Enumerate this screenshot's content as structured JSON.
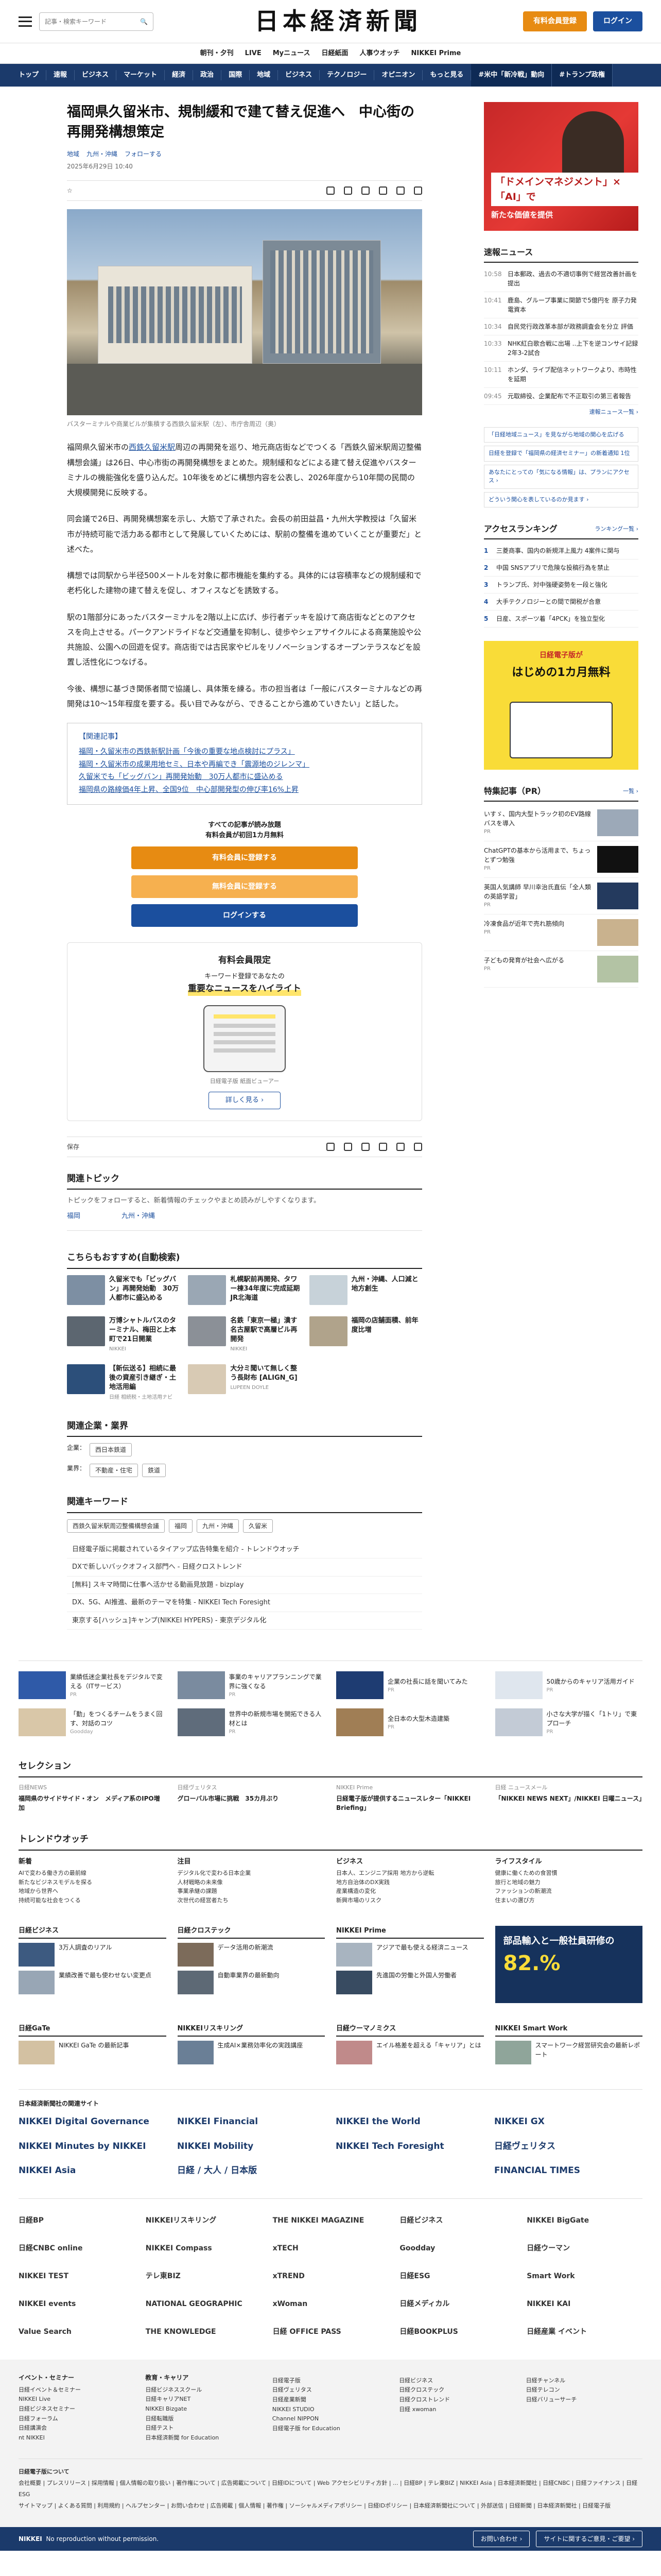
{
  "header": {
    "search_placeholder": "記事・検索キーワード",
    "logo": "日本経済新聞",
    "subscribe_label": "有料会員登録",
    "login_label": "ログイン"
  },
  "subnav": [
    "朝刊・夕刊",
    "LIVE",
    "Myニュース",
    "日経紙面",
    "人事ウオッチ",
    "NIKKEI Prime"
  ],
  "mainnav": [
    "トップ",
    "速報",
    "ビジネス",
    "マーケット",
    "経済",
    "政治",
    "国際",
    "地域",
    "ビジネス",
    "テクノロジー",
    "オピニオン",
    "もっと見る",
    "#米中「新冷戦」動向",
    "#トランプ政権"
  ],
  "article": {
    "title": "福岡県久留米市、規制緩和で建て替え促進へ　中心街の再開発構想策定",
    "tags": [
      "地域",
      "九州・沖縄"
    ],
    "follow": "フォローする",
    "date": "2025年6月29日 10:40",
    "save": "保存",
    "caption": "バスターミナルや商業ビルが集積する西鉄久留米駅（左）、市庁舎周辺（奥）",
    "p1_a": "福岡県久留米市の",
    "p1_link": "西鉄久留米駅",
    "p1_b": "周辺の再開発を巡り、地元商店街などでつくる「西鉄久留米駅周辺整備構想会議」は26日、中心市街の再開発構想をまとめた。規制緩和などによる建て替え促進やバスターミナルの機能強化を盛り込んだ。10年後をめどに構想内容を公表し、2026年度から10年間の民間の大規模開発に反映する。",
    "p2": "同会議で26日、再開発構想案を示し、大筋で了承された。会長の前田益昌・九州大学教授は「久留米市が持続可能で活力ある都市として発展していくためには、駅前の整備を進めていくことが重要だ」と述べた。",
    "p3": "構想では同駅から半径500メートルを対象に都市機能を集約する。具体的には容積率などの規制緩和で老朽化した建物の建て替えを促し、オフィスなどを誘致する。",
    "p4": "駅の1階部分にあったバスターミナルを2階以上に広げ、歩行者デッキを設けて商店街などとのアクセスを向上させる。パークアンドライドなど交通量を抑制し、徒歩やシェアサイクルによる商業施設や公共施設、公園への回遊を促す。商店街では古民家やビルをリノベーションするオープンテラスなどを設置し活性化につなげる。",
    "p5": "今後、構想に基づき関係者間で協議し、具体策を練る。市の担当者は「一般にバスターミナルなどの再開発は10〜15年程度を要する。長い目でみながら、できることから進めていきたい」と話した。",
    "related_title": "【関連記事】",
    "related": [
      "福岡・久留米市の西鉄新駅計画「今後の重要な地点検討にプラス」",
      "福岡・久留米市の成果用地セミ、日本や再編でき「震源地のジレンマ」",
      "久留米でも「ビッグバン」再開発始動　30万人都市に盛込める",
      "福岡県の路線価4年上昇、全国9位　中心部開発型の伸び率16%上昇"
    ]
  },
  "paywall": {
    "note1": "すべての記事が読み放題",
    "note2": "有料会員が初回1カ月無料",
    "btn_primary": "有料会員に登録する",
    "btn_secondary": "無料会員に登録する",
    "btn_login": "ログインする"
  },
  "promo": {
    "title": "有料会員限定",
    "line": "キーワード登録であなたの",
    "highlight": "重要なニュースをハイライト",
    "device_caption": "日経電子版 紙面ビューアー",
    "more": "詳しく見る ›"
  },
  "topic": {
    "title": "関連トピック",
    "desc": "トピックをフォローすると、新着情報のチェックやまとめ読みがしやすくなります。",
    "items": [
      "福岡",
      "九州・沖縄"
    ]
  },
  "recommend": {
    "title": "こちらもおすすめ(自動検索)",
    "items": [
      {
        "t": "久留米でも「ビッグバン」再開発始動　30万人都市に盛込める",
        "s": ""
      },
      {
        "t": "札幌駅前再開発、タワー棟34年度に完成延期　JR北海道",
        "s": ""
      },
      {
        "t": "九州・沖縄、人口減と地方創生",
        "s": ""
      },
      {
        "t": "万博シャトルバスのターミナル、梅田と上本町で21日開業",
        "s": "NIKKEI"
      },
      {
        "t": "名鉄「東京一極」潰す 名古屋駅で高層ビル再開発",
        "s": "NIKKEI"
      },
      {
        "t": "福岡の店舗面積、前年度比増",
        "s": ""
      },
      {
        "t": "【新伝送る】相続に最後の資産引き継ぎ・土地活用編",
        "s": "日経 相続税・土地活用ナビ"
      },
      {
        "t": "大分ミ聞いて無しく整う長財布 [ALIGN_G]",
        "s": "LUPEEN DOYLE"
      },
      {
        "t": "",
        "s": ""
      }
    ]
  },
  "related_company": {
    "title": "関連企業・業界",
    "company_label": "企業：",
    "companies": [
      "西日本鉄道"
    ],
    "industry_label": "業界：",
    "industries": [
      "不動産・住宅",
      "鉄道"
    ]
  },
  "keywords": {
    "title": "関連キーワード",
    "items": [
      "西鉄久留米駅周辺整備構想会議",
      "福岡",
      "九州・沖縄",
      "久留米"
    ]
  },
  "keyword_links": [
    "日経電子版に掲載されているタイアップ広告特集を紹介 - トレンドウオッチ",
    "DXで新しいバックオフィス部門へ - 日経クロストレンド",
    "[無料] スキマ時間に仕事へ活かせる動画見放題 - bizplay",
    "DX、5G、AI推進、最新のテーマを特集 - NIKKEI Tech Foresight",
    "東京する[ハッシュ]キャンプ(NIKKEI HYPERS) - 東京デジタル化"
  ],
  "sidebar": {
    "ad_title": "「ドメインマネジメント」×「AI」で",
    "ad_sub": "新たな価値を提供",
    "news_title": "速報ニュース",
    "news": [
      {
        "t": "10:58",
        "h": "日本郵政、過去の不適切事例で経営改善計画を提出"
      },
      {
        "t": "10:41",
        "h": "鹿島、グループ事業に関節で5億円を 原子力発電資本"
      },
      {
        "t": "10:34",
        "h": "自民党行政改革本部が政務調査会を分立 評価"
      },
      {
        "t": "10:33",
        "h": "NHK紅白歌合戦に出場 ..上下を逆コンサイ記録 2年3-2試合"
      },
      {
        "t": "10:11",
        "h": "ホンダ、ライブ配信ネットワークより、市時性を延期"
      },
      {
        "t": "09:45",
        "h": "元取締役、企業配布で不正取引の第三者報告"
      }
    ],
    "news_more": "速報ニュース一覧 ›",
    "follow_hint": "「日経地域ニュース」を見ながら地域の関心を広げる",
    "links": [
      "日経を登録で「福岡県の経済セミナー」の新着通知 1位",
      "あなたにとっての「気になる情報」は、プランにアクセス ›",
      "どういう関心を表しているのか見ます ›"
    ],
    "rank_title": "アクセスランキング",
    "rank_more": "ランキング一覧 ›",
    "ranks": [
      "三菱商事、国内の新規洋上風力 4案件に関与",
      "中国 SNSアプリで危険な投稿行為を禁止",
      "トランプ氏、対中強硬姿勢を一段と強化",
      "大手テクノロジーとの間で関税が合意",
      "日産、スポーツ着「4PCK」を独立型化"
    ],
    "ad2_line1": "日経電子版が",
    "ad2_line2": "はじめの1カ月無料",
    "feat_title": "特集記事（PR）",
    "feat_more": "一覧 ›",
    "feats": [
      {
        "h": "いすゞ、国内大型トラック初のEV路線バスを導入",
        "s": "PR"
      },
      {
        "h": "ChatGPTの基本から活用まで、ちょっとずつ勉強",
        "s": "PR"
      },
      {
        "h": "英国人気講師 早川幸治氏直伝「全人類の英語学習」",
        "s": "PR"
      },
      {
        "h": "冷凍食品が近年で売れ筋傾向",
        "s": "PR"
      },
      {
        "h": "子どもの発育が社会へ広がる",
        "s": "PR"
      }
    ]
  },
  "ad_grid": [
    {
      "t": "業績低迷企業社長をデジタルで変える（ITサービス）",
      "s": "PR"
    },
    {
      "t": "事業のキャリアプランニングで業界に強くなる",
      "s": "PR"
    },
    {
      "t": "企業の社長に話を聞いてみた",
      "s": "PR"
    },
    {
      "t": "50歳からのキャリア活用ガイド",
      "s": "PR"
    },
    {
      "t": "「勤」をつくるチームをうまく回す、対話のコツ",
      "s": "Goodday"
    },
    {
      "t": "世界中の新規市場を開拓できる人材とは",
      "s": "PR"
    },
    {
      "t": "全日本の大型木造建築",
      "s": "PR"
    },
    {
      "t": "小さな大学が描く「1トリ」で東プローチ",
      "s": "PR"
    }
  ],
  "selection": {
    "title": "セレクション",
    "cards": [
      {
        "t": "日経NEWS",
        "h": "福岡県のサイドサイド・オン　メディア系のIPO増加"
      },
      {
        "t": "日経ヴェリタス",
        "h": "グローバル市場に挑戦　35カ月ぶり"
      },
      {
        "t": "NIKKEI Prime",
        "h": "日経電子版が提供するニュースレター「NIKKEI Briefing」"
      },
      {
        "t": "日経 ニュースメール",
        "h": "「NIKKEI NEWS NEXT」/NIKKEI 日曜ニュース」"
      }
    ]
  },
  "trend": {
    "title": "トレンドウオッチ",
    "cols": [
      {
        "h": "新着",
        "items": [
          "AIで変わる働き方の最前線",
          "新たなビジネスモデルを探る",
          "地域から世界へ",
          "持続可能な社会をつくる"
        ]
      },
      {
        "h": "注目",
        "items": [
          "デジタル化で変わる日本企業",
          "人材戦略の未来像",
          "事業承継の課題",
          "次世代の経営者たち"
        ]
      },
      {
        "h": "ビジネス",
        "items": [
          "日本人、エンジニア採用 地方から逆転",
          "地方自治体のDX実践",
          "産業構造の変化",
          "新興市場のリスク"
        ]
      },
      {
        "h": "ライフスタイル",
        "items": [
          "健康に働くための食習慣",
          "旅行と地域の魅力",
          "ファッションの新潮流",
          "住まいの選び方"
        ]
      }
    ]
  },
  "blocks": [
    {
      "h": "日経ビジネス",
      "items": [
        "3万人調査のリアル",
        "業績改善で最も使わせない変更点"
      ]
    },
    {
      "h": "日経クロステック",
      "items": [
        "データ活用の新潮流",
        "自動車業界の最新動向"
      ]
    },
    {
      "h": "NIKKEI Prime",
      "items": [
        "アジアで最も使える経済ニュース",
        "先進国の労働と外国人労働者"
      ]
    },
    {
      "h": "",
      "items": []
    }
  ],
  "eco_ad": {
    "l1": "部品輸入と一般社員研修の",
    "l2": "82.",
    "l3": "%"
  },
  "blocks2": [
    {
      "h": "日経GaTe",
      "items": [
        "NIKKEI GaTe の最新記事"
      ]
    },
    {
      "h": "NIKKEIリスキリング",
      "items": [
        "生成AI×業務効率化の実践講座"
      ]
    },
    {
      "h": "日経ウーマノミクス",
      "items": [
        "エイル格差を超える「キャリア」とは"
      ]
    },
    {
      "h": "NIKKEI Smart Work",
      "items": [
        "スマートワーク経営研究会の最新レポート"
      ]
    }
  ],
  "brands_title": "日本経済新聞社の関連サイト",
  "brands": [
    "NIKKEI Digital Governance",
    "NIKKEI Financial",
    "NIKKEI the World",
    "NIKKEI GX",
    "NIKKEI Minutes by NIKKEI",
    "NIKKEI Mobility",
    "NIKKEI Tech Foresight",
    "日経ヴェリタス",
    "NIKKEI Asia",
    "日経 / 大人 / 日本版",
    "",
    "FINANCIAL TIMES"
  ],
  "logos": [
    "日経BP",
    "NIKKEIリスキリング",
    "THE NIKKEI MAGAZINE",
    "日経ビジネス",
    "NIKKEI BigGate",
    "日経CNBC online",
    "NIKKEI Compass",
    "xTECH",
    "Goodday",
    "日経ウーマン",
    "NIKKEI TEST",
    "テレ東BIZ",
    "xTREND",
    "日経ESG",
    "Smart Work",
    "NIKKEI events",
    "NATIONAL GEOGRAPHIC",
    "xWoman",
    "日経メディカル",
    "NIKKEI KAI",
    "Value Search",
    "THE KNOWLEDGE",
    "日経 OFFICE PASS",
    "日経BOOKPLUS",
    "日経産業 イベント"
  ],
  "footer": {
    "cols": [
      {
        "h": "イベント・セミナー",
        "items": [
          "日経イベント＆セミナー",
          "NIKKEI Live",
          "日経ビジネスセミナー",
          "日経フォーラム",
          "日経講演会",
          "nt NIKKEI"
        ]
      },
      {
        "h": "教育・キャリア",
        "items": [
          "日経ビジネススクール",
          "日経キャリアNET",
          "NIKKEI Bizgate",
          "日経転職版",
          "日経テスト",
          "日本経済新聞 for Education"
        ]
      },
      {
        "h": "",
        "items": [
          "日経電子版",
          "日経ヴェリタス",
          "日経産業新聞",
          "NIKKEI STUDIO",
          "Channel NIPPON",
          "日経電子版 for Education"
        ]
      },
      {
        "h": "",
        "items": [
          "日経ビジネス",
          "日経クロステック",
          "日経クロストレンド",
          "日経 xwoman"
        ]
      },
      {
        "h": "",
        "items": [
          "日経チャンネル",
          "日経テレコン",
          "日経バリューサーチ"
        ]
      }
    ],
    "links_title": "日経電子版について",
    "links1": "会社概要 | プレスリリース | 採用情報 | 個人情報の取り扱い | 著作権について | 広告掲載について | 日経IDについて | Web アクセシビリティ方針 | ... | 日経BP | テレ東BIZ | NIKKEI Asia | 日本経済新聞社 | 日経CNBC | 日経ファイナンス | 日経ESG",
    "links2": "サイトマップ | よくある質問 | 利用規約 | ヘルプセンター | お問い合わせ | 広告掲載 | 個人情報 | 著作権 | ソーシャルメディアポリシー | 日経IDポリシー | 日本経済新聞社について | 外部送信 | 日経新聞 | 日本経済新聞社 | 日経電子版"
  },
  "bottom": {
    "logo": "NIKKEI",
    "copy": "No reproduction without permission.",
    "btn1": "お問い合わせ ›",
    "btn2": "サイトに関するご意見・ご要望 ›"
  }
}
